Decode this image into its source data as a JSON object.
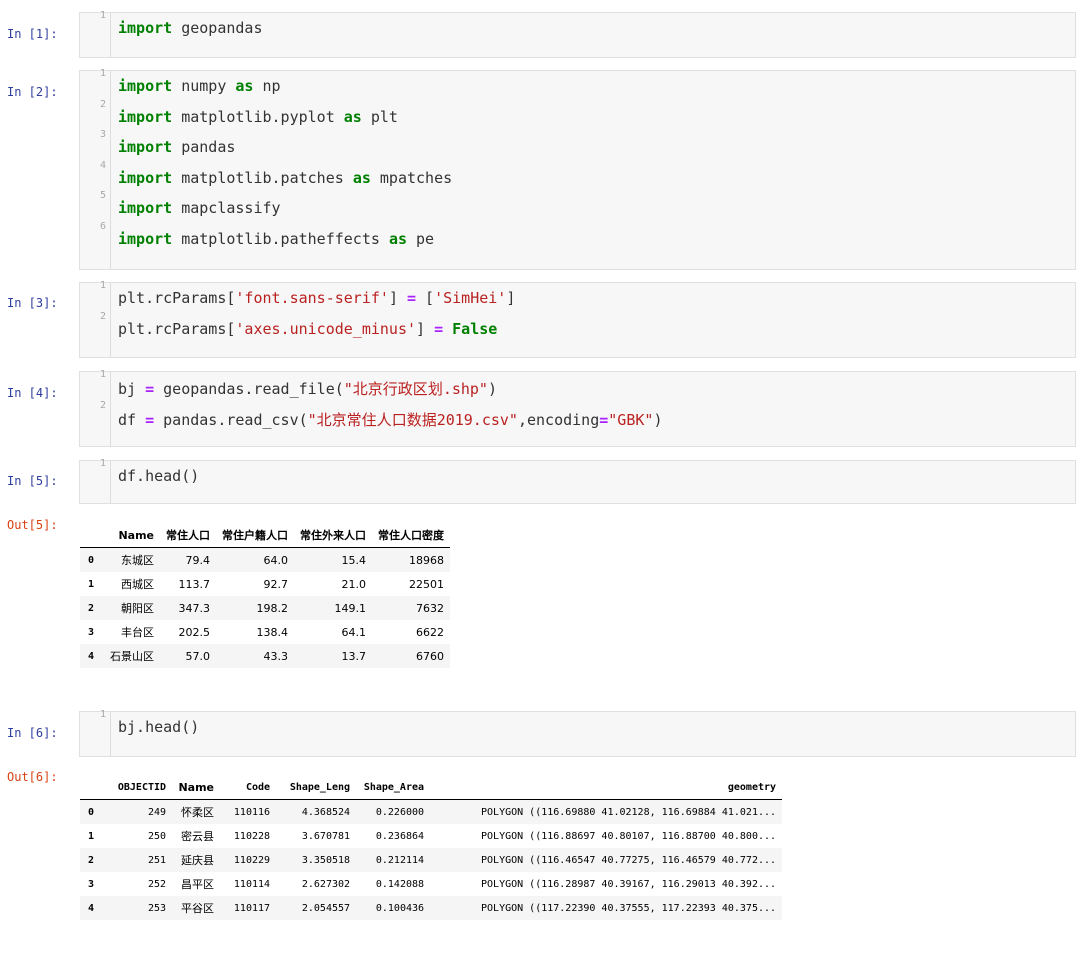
{
  "cells": [
    {
      "in": "In [1]:",
      "lines": [
        [
          {
            "t": "kw",
            "v": "import"
          },
          {
            "t": "p",
            "v": " geopandas"
          }
        ]
      ]
    },
    {
      "in": "In [2]:",
      "lines": [
        [
          {
            "t": "kw",
            "v": "import"
          },
          {
            "t": "p",
            "v": " numpy "
          },
          {
            "t": "kw",
            "v": "as"
          },
          {
            "t": "p",
            "v": " np"
          }
        ],
        [
          {
            "t": "kw",
            "v": "import"
          },
          {
            "t": "p",
            "v": " matplotlib.pyplot "
          },
          {
            "t": "kw",
            "v": "as"
          },
          {
            "t": "p",
            "v": " plt"
          }
        ],
        [
          {
            "t": "kw",
            "v": "import"
          },
          {
            "t": "p",
            "v": " pandas"
          }
        ],
        [
          {
            "t": "kw",
            "v": "import"
          },
          {
            "t": "p",
            "v": " matplotlib.patches "
          },
          {
            "t": "kw",
            "v": "as"
          },
          {
            "t": "p",
            "v": " mpatches"
          }
        ],
        [
          {
            "t": "kw",
            "v": "import"
          },
          {
            "t": "p",
            "v": " mapclassify"
          }
        ],
        [
          {
            "t": "kw",
            "v": "import"
          },
          {
            "t": "p",
            "v": " matplotlib.patheffects "
          },
          {
            "t": "kw",
            "v": "as"
          },
          {
            "t": "p",
            "v": " pe"
          }
        ]
      ]
    },
    {
      "in": "In [3]:",
      "lines": [
        [
          {
            "t": "p",
            "v": "plt.rcParams["
          },
          {
            "t": "str",
            "v": "'font.sans-serif'"
          },
          {
            "t": "p",
            "v": "] "
          },
          {
            "t": "op",
            "v": "="
          },
          {
            "t": "p",
            "v": " ["
          },
          {
            "t": "str",
            "v": "'SimHei'"
          },
          {
            "t": "p",
            "v": "]"
          }
        ],
        [
          {
            "t": "p",
            "v": "plt.rcParams["
          },
          {
            "t": "str",
            "v": "'axes.unicode_minus'"
          },
          {
            "t": "p",
            "v": "] "
          },
          {
            "t": "op",
            "v": "="
          },
          {
            "t": "p",
            "v": " "
          },
          {
            "t": "bool",
            "v": "False"
          }
        ]
      ]
    },
    {
      "in": "In [4]:",
      "lines": [
        [
          {
            "t": "p",
            "v": "bj "
          },
          {
            "t": "op",
            "v": "="
          },
          {
            "t": "p",
            "v": " geopandas.read_file("
          },
          {
            "t": "str",
            "v": "\"北京行政区划.shp\""
          },
          {
            "t": "p",
            "v": ")"
          }
        ],
        [
          {
            "t": "p",
            "v": "df "
          },
          {
            "t": "op",
            "v": "="
          },
          {
            "t": "p",
            "v": " pandas.read_csv("
          },
          {
            "t": "str",
            "v": "\"北京常住人口数据2019.csv\""
          },
          {
            "t": "p",
            "v": ",encoding"
          },
          {
            "t": "op",
            "v": "="
          },
          {
            "t": "str",
            "v": "\"GBK\""
          },
          {
            "t": "p",
            "v": ")"
          }
        ]
      ]
    },
    {
      "in": "In [5]:",
      "lines": [
        [
          {
            "t": "p",
            "v": "df.head()"
          }
        ]
      ]
    },
    {
      "in": "In [6]:",
      "lines": [
        [
          {
            "t": "p",
            "v": "bj.head()"
          }
        ]
      ]
    }
  ],
  "out5": {
    "prompt": "Out[5]:",
    "columns": [
      "",
      "Name",
      "常住人口",
      "常住户籍人口",
      "常住外来人口",
      "常住人口密度"
    ],
    "rows": [
      [
        "0",
        "东城区",
        "79.4",
        "64.0",
        "15.4",
        "18968"
      ],
      [
        "1",
        "西城区",
        "113.7",
        "92.7",
        "21.0",
        "22501"
      ],
      [
        "2",
        "朝阳区",
        "347.3",
        "198.2",
        "149.1",
        "7632"
      ],
      [
        "3",
        "丰台区",
        "202.5",
        "138.4",
        "64.1",
        "6622"
      ],
      [
        "4",
        "石景山区",
        "57.0",
        "43.3",
        "13.7",
        "6760"
      ]
    ]
  },
  "out6": {
    "prompt": "Out[6]:",
    "columns": [
      "",
      "OBJECTID",
      "Name",
      "Code",
      "Shape_Leng",
      "Shape_Area",
      "geometry"
    ],
    "rows": [
      [
        "0",
        "249",
        "怀柔区",
        "110116",
        "4.368524",
        "0.226000",
        "POLYGON ((116.69880 41.02128, 116.69884 41.021..."
      ],
      [
        "1",
        "250",
        "密云县",
        "110228",
        "3.670781",
        "0.236864",
        "POLYGON ((116.88697 40.80107, 116.88700 40.800..."
      ],
      [
        "2",
        "251",
        "延庆县",
        "110229",
        "3.350518",
        "0.212114",
        "POLYGON ((116.46547 40.77275, 116.46579 40.772..."
      ],
      [
        "3",
        "252",
        "昌平区",
        "110114",
        "2.627302",
        "0.142088",
        "POLYGON ((116.28987 40.39167, 116.29013 40.392..."
      ],
      [
        "4",
        "253",
        "平谷区",
        "110117",
        "2.054557",
        "0.100436",
        "POLYGON ((117.22390 40.37555, 117.22393 40.375..."
      ]
    ]
  }
}
